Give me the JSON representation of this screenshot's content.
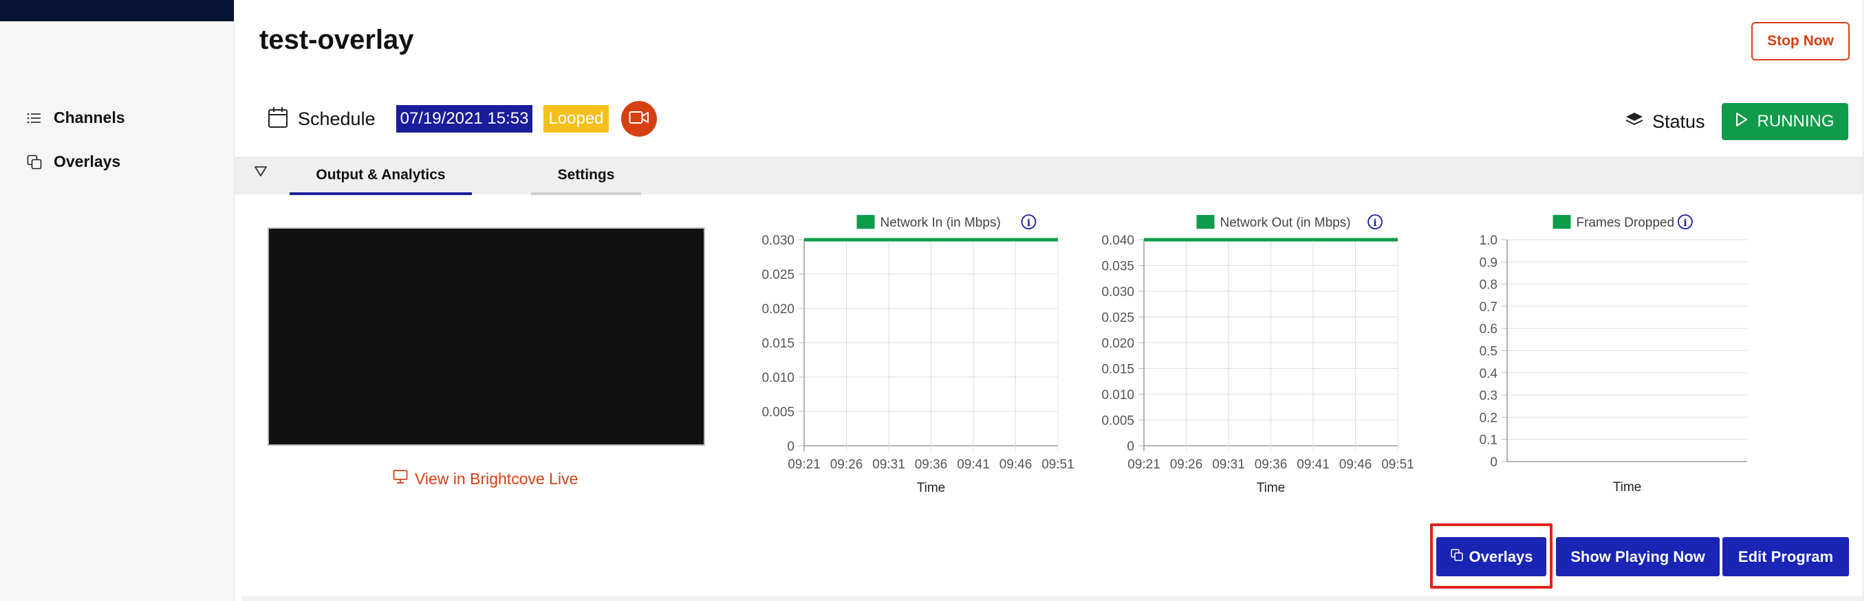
{
  "sidebar": {
    "items": [
      {
        "label": "Channels",
        "icon": "list-icon"
      },
      {
        "label": "Overlays",
        "icon": "copy-icon"
      }
    ]
  },
  "header": {
    "title": "test-overlay",
    "stop_label": "Stop Now"
  },
  "info": {
    "schedule_label": "Schedule",
    "date": "07/19/2021 15:53",
    "looped": "Looped",
    "status_label": "Status",
    "running_label": "RUNNING"
  },
  "tabs": [
    {
      "label": "Output & Analytics",
      "active": true
    },
    {
      "label": "Settings",
      "active": false
    }
  ],
  "preview": {
    "link_label": "View in Brightcove Live"
  },
  "colors": {
    "accent_blue": "#1a24b5",
    "alert_orange": "#d63f12",
    "running_green": "#0f9b4b",
    "series_green": "#0f9b4b",
    "looped_yellow": "#f5c01b",
    "highlight_red": "#e0231c"
  },
  "chart_data": [
    {
      "type": "line",
      "legend": "Network In (in Mbps)",
      "xlabel": "Time",
      "x": [
        "09:21",
        "09:26",
        "09:31",
        "09:36",
        "09:41",
        "09:46",
        "09:51"
      ],
      "yticks": [
        "0",
        "0.005",
        "0.010",
        "0.015",
        "0.020",
        "0.025",
        "0.030"
      ],
      "ylim": [
        0,
        0.03
      ],
      "series": [
        {
          "name": "Network In (in Mbps)",
          "values": [
            0.03,
            0.03,
            0.03,
            0.03,
            0.03,
            0.03,
            0.03
          ]
        }
      ],
      "grid": true
    },
    {
      "type": "line",
      "legend": "Network Out (in Mbps)",
      "xlabel": "Time",
      "x": [
        "09:21",
        "09:26",
        "09:31",
        "09:36",
        "09:41",
        "09:46",
        "09:51"
      ],
      "yticks": [
        "0",
        "0.005",
        "0.010",
        "0.015",
        "0.020",
        "0.025",
        "0.030",
        "0.035",
        "0.040"
      ],
      "ylim": [
        0,
        0.04
      ],
      "series": [
        {
          "name": "Network Out (in Mbps)",
          "values": [
            0.04,
            0.04,
            0.04,
            0.04,
            0.04,
            0.04,
            0.04
          ]
        }
      ],
      "grid": true
    },
    {
      "type": "line",
      "legend": "Frames Dropped",
      "xlabel": "Time",
      "x": [],
      "yticks": [
        "0",
        "0.1",
        "0.2",
        "0.3",
        "0.4",
        "0.5",
        "0.6",
        "0.7",
        "0.8",
        "0.9",
        "1.0"
      ],
      "ylim": [
        0,
        1
      ],
      "series": [
        {
          "name": "Frames Dropped",
          "values": []
        }
      ],
      "grid": true
    }
  ],
  "actions": {
    "overlays_label": "Overlays",
    "show_playing_label": "Show Playing Now",
    "edit_program_label": "Edit Program"
  }
}
